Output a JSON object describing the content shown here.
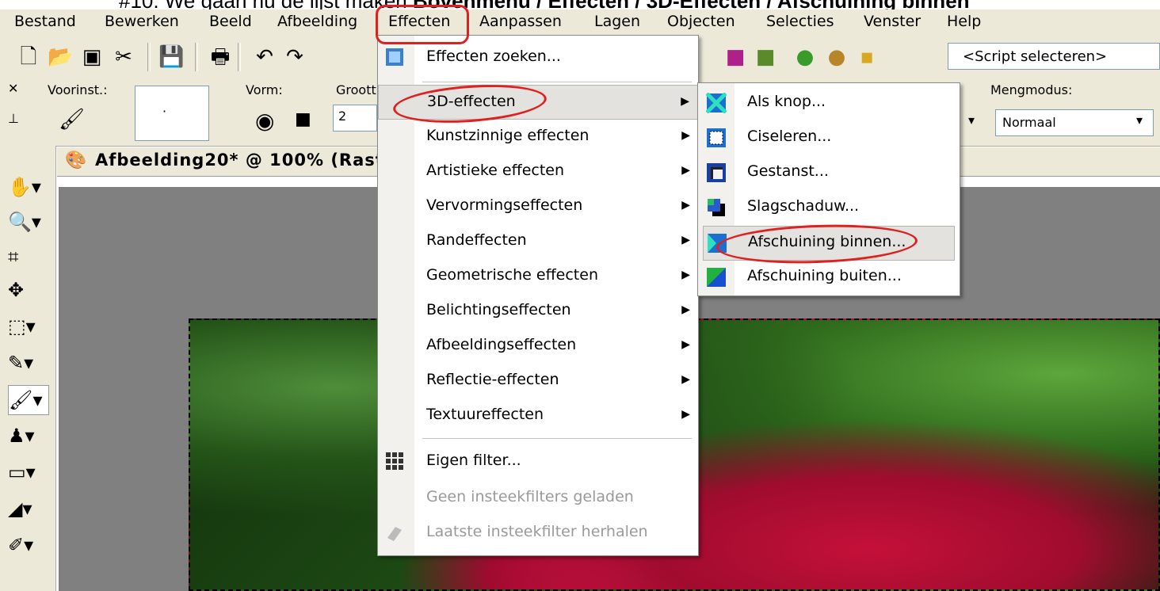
{
  "caption": {
    "prefix": "#10. We gaan nu de lijst maken ",
    "bold": "Bovenmenu / Effecten / 3D-Effecten / Afschuining binnen"
  },
  "menubar": [
    "Bestand",
    "Bewerken",
    "Beeld",
    "Afbeelding",
    "Effecten",
    "Aanpassen",
    "Lagen",
    "Objecten",
    "Selecties",
    "Venster",
    "Help"
  ],
  "toolbar": {
    "script_select": "<Script selecteren>"
  },
  "tool_options": {
    "preset_label": "Voorinst.:",
    "shape_label": "Vorm:",
    "size_label": "Groott",
    "size_value": "2",
    "blend_label": "Mengmodus:",
    "blend_value": "Normaal",
    "dot": "·"
  },
  "document": {
    "title": "Afbeelding20* @ 100% (Raste"
  },
  "effects_menu": {
    "items": [
      {
        "label": "Effecten zoeken...",
        "submenu": false
      },
      {
        "label": "3D-effecten",
        "submenu": true
      },
      {
        "label": "Kunstzinnige effecten",
        "submenu": true
      },
      {
        "label": "Artistieke effecten",
        "submenu": true
      },
      {
        "label": "Vervormingseffecten",
        "submenu": true
      },
      {
        "label": "Randeffecten",
        "submenu": true
      },
      {
        "label": "Geometrische effecten",
        "submenu": true
      },
      {
        "label": "Belichtingseffecten",
        "submenu": true
      },
      {
        "label": "Afbeeldingseffecten",
        "submenu": true
      },
      {
        "label": "Reflectie-effecten",
        "submenu": true
      },
      {
        "label": "Textuureffecten",
        "submenu": true
      },
      {
        "label": "Eigen filter...",
        "submenu": false
      },
      {
        "label": "Geen insteekfilters geladen",
        "submenu": false,
        "disabled": true
      },
      {
        "label": "Laatste insteekfilter herhalen",
        "submenu": false,
        "disabled": true
      }
    ]
  },
  "submenu_3d": {
    "items": [
      {
        "label": "Als knop...",
        "icon": "button-effect-icon"
      },
      {
        "label": "Ciseleren...",
        "icon": "chisel-icon"
      },
      {
        "label": "Gestanst...",
        "icon": "cutout-icon"
      },
      {
        "label": "Slagschaduw...",
        "icon": "drop-shadow-icon"
      },
      {
        "label": "Afschuining binnen...",
        "icon": "inner-bevel-icon"
      },
      {
        "label": "Afschuining buiten...",
        "icon": "outer-bevel-icon"
      }
    ]
  },
  "colors": {
    "annotation": "#e0201e",
    "menu_bg": "#ffffff",
    "chrome": "#ece9d8"
  }
}
